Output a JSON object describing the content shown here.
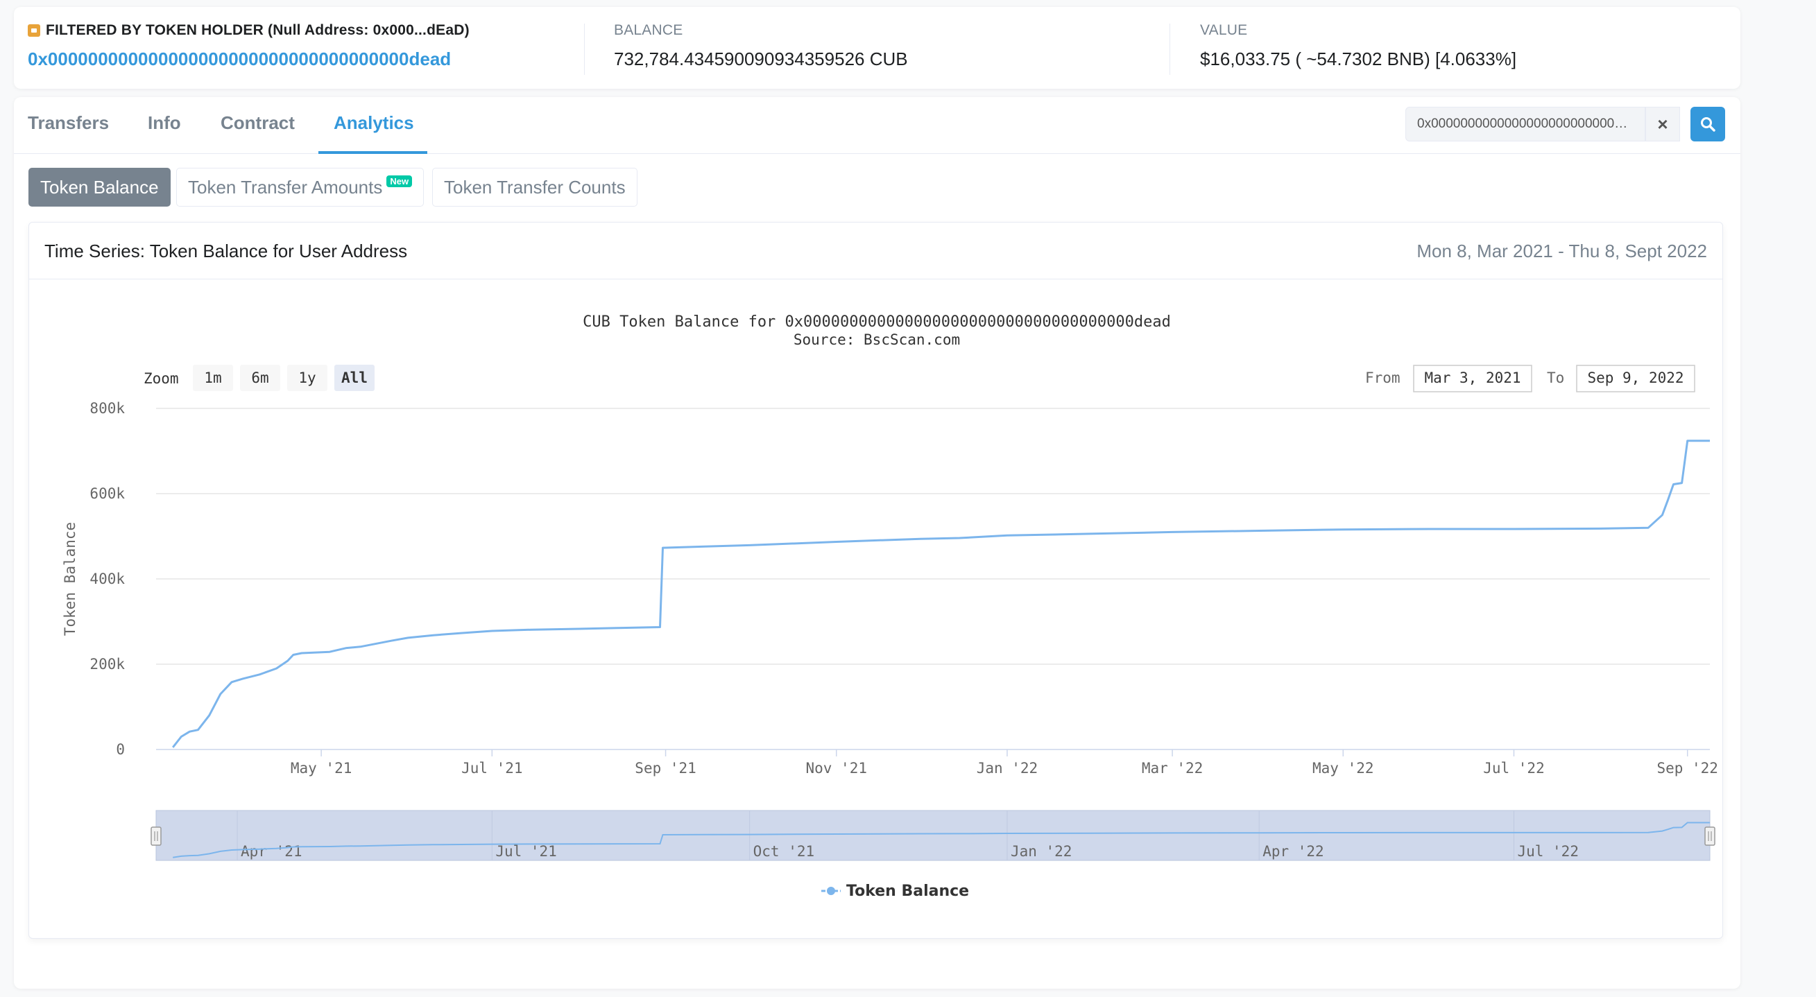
{
  "holder": {
    "label": "FILTERED BY TOKEN HOLDER (Null Address: 0x000...dEaD)",
    "address": "0x000000000000000000000000000000000000dead"
  },
  "balance": {
    "label": "BALANCE",
    "value": "732,784.434590090934359526 CUB"
  },
  "value": {
    "label": "VALUE",
    "value": "$16,033.75 ( ~54.7302 BNB) [4.0633%]"
  },
  "tabs": [
    {
      "label": "Transfers"
    },
    {
      "label": "Info"
    },
    {
      "label": "Contract"
    },
    {
      "label": "Analytics"
    }
  ],
  "search": {
    "value": "0x000000000000000000000000000..."
  },
  "subtabs": [
    {
      "label": "Token Balance"
    },
    {
      "label": "Token Transfer Amounts",
      "badge": "New"
    },
    {
      "label": "Token Transfer Counts"
    }
  ],
  "panel": {
    "title": "Time Series: Token Balance for User Address",
    "range": "Mon 8, Mar 2021 - Thu 8, Sept 2022"
  },
  "chart_data": {
    "type": "line",
    "title": "CUB Token Balance for 0x000000000000000000000000000000000000dead",
    "subtitle": "Source: BscScan.com",
    "ylabel": "Token Balance",
    "ylim": [
      0,
      800000
    ],
    "yticks": [
      "0",
      "200k",
      "400k",
      "600k",
      "800k"
    ],
    "xticks": [
      "May '21",
      "Jul '21",
      "Sep '21",
      "Nov '21",
      "Jan '22",
      "Mar '22",
      "May '22",
      "Jul '22",
      "Sep '22"
    ],
    "zoom": {
      "label": "Zoom",
      "buttons": [
        "1m",
        "6m",
        "1y",
        "All"
      ],
      "selected": "All"
    },
    "range": {
      "from_label": "From",
      "from": "Mar 3, 2021",
      "to_label": "To",
      "to": "Sep 9, 2022"
    },
    "navigator_ticks": [
      "Apr '21",
      "Jul '21",
      "Oct '21",
      "Jan '22",
      "Apr '22",
      "Jul '22"
    ],
    "legend": "Token Balance",
    "color": "#7cb5ec",
    "series": [
      {
        "name": "Token Balance",
        "x": [
          "2021-03-09",
          "2021-03-12",
          "2021-03-15",
          "2021-03-18",
          "2021-03-22",
          "2021-03-26",
          "2021-03-30",
          "2021-04-03",
          "2021-04-09",
          "2021-04-15",
          "2021-04-19",
          "2021-04-21",
          "2021-04-24",
          "2021-05-04",
          "2021-05-10",
          "2021-05-15",
          "2021-05-26",
          "2021-06-01",
          "2021-06-10",
          "2021-06-20",
          "2021-07-01",
          "2021-07-15",
          "2021-08-01",
          "2021-08-15",
          "2021-08-30",
          "2021-08-31",
          "2021-09-15",
          "2021-10-01",
          "2021-11-01",
          "2021-12-01",
          "2021-12-15",
          "2022-01-01",
          "2022-02-01",
          "2022-03-01",
          "2022-04-01",
          "2022-05-01",
          "2022-06-01",
          "2022-07-01",
          "2022-08-01",
          "2022-08-18",
          "2022-08-23",
          "2022-08-25",
          "2022-08-27",
          "2022-08-30",
          "2022-08-31",
          "2022-09-01",
          "2022-09-09"
        ],
        "y": [
          5000,
          30000,
          42000,
          46000,
          80000,
          130000,
          158000,
          166000,
          176000,
          190000,
          208000,
          222000,
          226000,
          229000,
          238000,
          241000,
          255000,
          262000,
          268000,
          273000,
          278000,
          281000,
          283000,
          285000,
          287000,
          473000,
          476000,
          479000,
          487000,
          494000,
          496000,
          502000,
          506000,
          510000,
          513000,
          516000,
          517000,
          517000,
          518000,
          520000,
          550000,
          585000,
          622000,
          625000,
          675000,
          724000,
          724000
        ]
      }
    ]
  }
}
